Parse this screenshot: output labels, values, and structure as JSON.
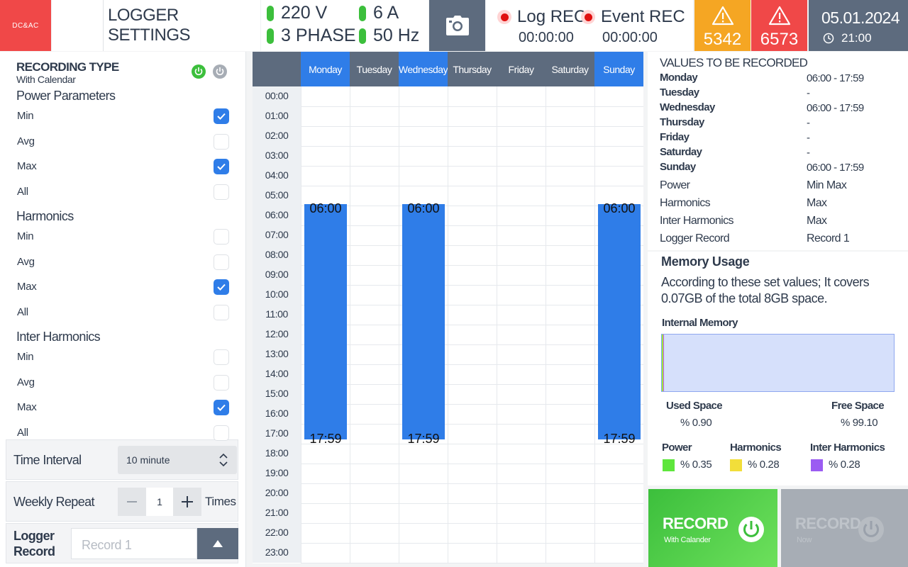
{
  "header": {
    "logo": "DC&AC",
    "title": "LOGGER SETTINGS",
    "voltage": "220 V",
    "current": "6 A",
    "phase": "3 PHASE",
    "frequency": "50 Hz",
    "log_rec_label": "Log REC",
    "log_rec_time": "00:00:00",
    "event_rec_label": "Event REC",
    "event_rec_time": "00:00:00",
    "alarm_warning_count": "5342",
    "alarm_critical_count": "6573",
    "date": "05.01.2024",
    "time": "21:00",
    "colors": {
      "warning": "#f5a623",
      "critical": "#f04848",
      "accent": "#2f7de8",
      "dark": "#5d6b7e"
    }
  },
  "recording": {
    "title": "RECORDING TYPE",
    "subtitle": "With Calendar",
    "groups": [
      {
        "title": "Power Parameters",
        "options": [
          {
            "label": "Min",
            "checked": true
          },
          {
            "label": "Avg",
            "checked": false
          },
          {
            "label": "Max",
            "checked": true
          },
          {
            "label": "All",
            "checked": false
          }
        ]
      },
      {
        "title": "Harmonics",
        "options": [
          {
            "label": "Min",
            "checked": false
          },
          {
            "label": "Avg",
            "checked": false
          },
          {
            "label": "Max",
            "checked": true
          },
          {
            "label": "All",
            "checked": false
          }
        ]
      },
      {
        "title": "Inter Harmonics",
        "options": [
          {
            "label": "Min",
            "checked": false
          },
          {
            "label": "Avg",
            "checked": false
          },
          {
            "label": "Max",
            "checked": true
          },
          {
            "label": "All",
            "checked": false
          }
        ]
      }
    ],
    "time_interval_label": "Time Interval",
    "time_interval_value": "10 minute",
    "weekly_repeat_label": "Weekly Repeat",
    "weekly_repeat_value": "1",
    "weekly_repeat_unit": "Times",
    "logger_record_label_1": "Logger",
    "logger_record_label_2": "Record",
    "logger_record_placeholder": "Record 1"
  },
  "calendar": {
    "days": [
      {
        "name": "Monday",
        "active": true
      },
      {
        "name": "Tuesday",
        "active": false
      },
      {
        "name": "Wednesday",
        "active": true
      },
      {
        "name": "Thursday",
        "active": false
      },
      {
        "name": "Friday",
        "active": false
      },
      {
        "name": "Saturday",
        "active": false
      },
      {
        "name": "Sunday",
        "active": true
      }
    ],
    "hours": [
      "00:00",
      "01:00",
      "02:00",
      "03:00",
      "04:00",
      "05:00",
      "06:00",
      "07:00",
      "08:00",
      "09:00",
      "10:00",
      "11:00",
      "12:00",
      "13:00",
      "14:00",
      "15:00",
      "16:00",
      "17:00",
      "18:00",
      "19:00",
      "20:00",
      "21:00",
      "22:00",
      "23:00"
    ],
    "blocks": [
      {
        "day": 0,
        "start": "06:00",
        "end": "17:59"
      },
      {
        "day": 2,
        "start": "06:00",
        "end": "17:59"
      },
      {
        "day": 6,
        "start": "06:00",
        "end": "17:59"
      }
    ]
  },
  "values": {
    "title": "VALUES TO BE RECORDED",
    "days": [
      {
        "day": "Monday",
        "value": "06:00 - 17:59"
      },
      {
        "day": "Tuesday",
        "value": "-"
      },
      {
        "day": "Wednesday",
        "value": "06:00 - 17:59"
      },
      {
        "day": "Thursday",
        "value": "-"
      },
      {
        "day": "Friday",
        "value": "-"
      },
      {
        "day": "Saturday",
        "value": "-"
      },
      {
        "day": "Sunday",
        "value": "06:00 - 17:59"
      }
    ],
    "params": [
      {
        "key": "Power",
        "value": "Min  Max"
      },
      {
        "key": "Harmonics",
        "value": "Max"
      },
      {
        "key": "Inter Harmonics",
        "value": "Max"
      },
      {
        "key": "Logger Record",
        "value": "Record 1"
      }
    ]
  },
  "memory": {
    "title": "Memory Usage",
    "description": "According to these set values; It covers 0.07GB of the total 8GB space.",
    "internal_title": "Internal Memory",
    "used_label": "Used Space",
    "used_value": "% 0.90",
    "used_fraction": 0.009,
    "free_label": "Free Space",
    "free_value": "% 99.10",
    "categories": [
      {
        "name": "Power",
        "value": "% 0.35",
        "color": "#5ee63c"
      },
      {
        "name": "Harmonics",
        "value": "% 0.28",
        "color": "#f2de3a"
      },
      {
        "name": "Inter Harmonics",
        "value": "% 0.28",
        "color": "#9b5cf2"
      }
    ]
  },
  "actions": {
    "record_calendar_title": "RECORD",
    "record_calendar_sub": "With Calander",
    "record_now_title": "RECORD",
    "record_now_sub": "Now"
  }
}
